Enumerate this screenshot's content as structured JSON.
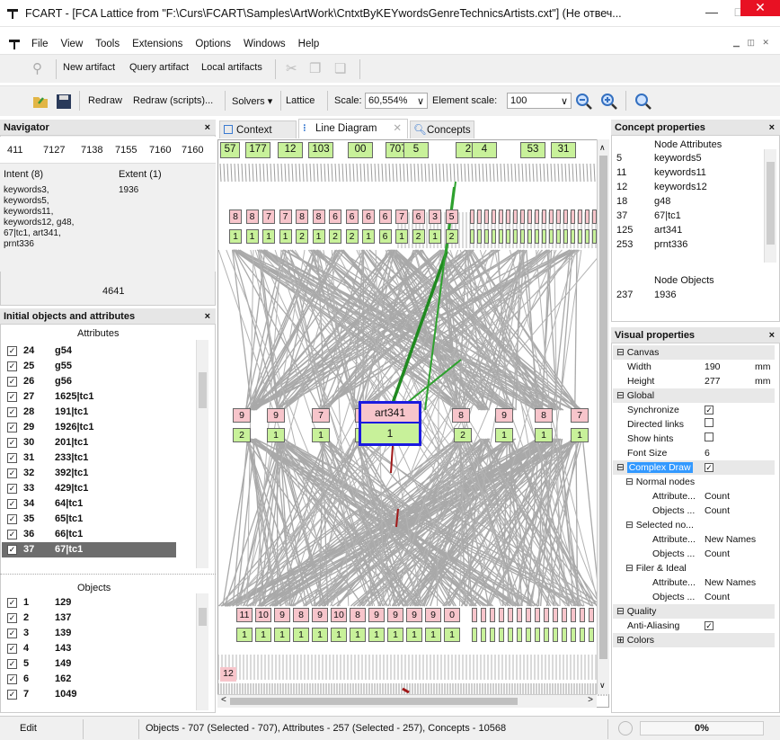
{
  "window": {
    "title": "FCART - [FCA Lattice from \"F:\\Curs\\FCART\\Samples\\ArtWork\\CntxtByKEYwordsGenreTechnicsArtists.cxt\"] (Не отвеч...",
    "minimize": "—",
    "maximize": "□",
    "close": "✕"
  },
  "menu": [
    "File",
    "View",
    "Tools",
    "Extensions",
    "Options",
    "Windows",
    "Help"
  ],
  "toolbar1": {
    "new_artifact": "New artifact",
    "query_artifact": "Query artifact",
    "local_artifacts": "Local artifacts"
  },
  "toolbar2": {
    "redraw": "Redraw",
    "redraw_scripts": "Redraw (scripts)...",
    "solvers": "Solvers ▾",
    "lattice": "Lattice",
    "scale_label": "Scale:",
    "scale_value": "60,554%",
    "element_scale_label": "Element scale:",
    "element_scale_value": "100"
  },
  "navigator": {
    "title": "Navigator",
    "close": "×",
    "numbers": [
      "411",
      "7127",
      "7138",
      "7155",
      "7160"
    ],
    "intent_header": "Intent (8)",
    "extent_header": "Extent (1)",
    "intent_text": "keywords3, keywords5, keywords11, keywords12, g48, 67|tc1, art341, prnt336",
    "extent_text": "1936",
    "bottom_value": "4641"
  },
  "initial": {
    "title": "Initial objects and attributes",
    "close": "×",
    "attributes_header": "Attributes",
    "attributes": [
      {
        "n": "24",
        "v": "g54"
      },
      {
        "n": "25",
        "v": "g55"
      },
      {
        "n": "26",
        "v": "g56"
      },
      {
        "n": "27",
        "v": "1625|tc1"
      },
      {
        "n": "28",
        "v": "191|tc1"
      },
      {
        "n": "29",
        "v": "1926|tc1"
      },
      {
        "n": "30",
        "v": "201|tc1"
      },
      {
        "n": "31",
        "v": "233|tc1"
      },
      {
        "n": "32",
        "v": "392|tc1"
      },
      {
        "n": "33",
        "v": "429|tc1"
      },
      {
        "n": "34",
        "v": "64|tc1"
      },
      {
        "n": "35",
        "v": "65|tc1"
      },
      {
        "n": "36",
        "v": "66|tc1"
      },
      {
        "n": "37",
        "v": "67|tc1"
      }
    ],
    "objects_header": "Objects",
    "objects": [
      {
        "n": "1",
        "v": "129"
      },
      {
        "n": "2",
        "v": "137"
      },
      {
        "n": "3",
        "v": "139"
      },
      {
        "n": "4",
        "v": "143"
      },
      {
        "n": "5",
        "v": "149"
      },
      {
        "n": "6",
        "v": "162"
      },
      {
        "n": "7",
        "v": "1049"
      }
    ]
  },
  "tabs": [
    "Context",
    "Line Diagram",
    "Concepts"
  ],
  "diagram": {
    "top_labels": [
      "57",
      "177",
      "12",
      "103",
      "00",
      "707",
      "5",
      "2",
      "4",
      "53",
      "31"
    ],
    "pink1": [
      "8",
      "8",
      "7",
      "7",
      "8",
      "8",
      "6",
      "6",
      "6",
      "6",
      "7",
      "6",
      "3",
      "5"
    ],
    "green1": [
      "1",
      "1",
      "1",
      "1",
      "2",
      "1",
      "2",
      "2",
      "1",
      "6",
      "1",
      "2",
      "1",
      "2"
    ],
    "mid_pink": [
      "9",
      "9",
      "7",
      "7",
      "8",
      "9",
      "8",
      "7"
    ],
    "mid_green": [
      "2",
      "1",
      "1",
      "1",
      "2",
      "1",
      "1",
      "1"
    ],
    "selected_top": "art341",
    "selected_bottom": "1",
    "pink3": [
      "11",
      "10",
      "9",
      "8",
      "9",
      "10",
      "8",
      "9",
      "9",
      "9",
      "9",
      "0"
    ],
    "green3": [
      "1",
      "1",
      "1",
      "1",
      "1",
      "1",
      "1",
      "1",
      "1",
      "1",
      "1",
      "1"
    ],
    "bottom_left": "12"
  },
  "concept_props": {
    "title": "Concept properties",
    "close": "×",
    "attr_header": "Node Attributes",
    "attrs": [
      {
        "n": "5",
        "v": "keywords5"
      },
      {
        "n": "11",
        "v": "keywords11"
      },
      {
        "n": "12",
        "v": "keywords12"
      },
      {
        "n": "18",
        "v": "g48"
      },
      {
        "n": "37",
        "v": "67|tc1"
      },
      {
        "n": "125",
        "v": "art341"
      },
      {
        "n": "253",
        "v": "prnt336"
      }
    ],
    "obj_header": "Node Objects",
    "objs": [
      {
        "n": "237",
        "v": "1936"
      }
    ]
  },
  "visual": {
    "title": "Visual properties",
    "close": "×",
    "canvas": "Canvas",
    "width_label": "Width",
    "width_value": "190",
    "width_unit": "mm",
    "height_label": "Height",
    "height_value": "277",
    "height_unit": "mm",
    "global": "Global",
    "synchronize": "Synchronize",
    "directed": "Directed links",
    "hints": "Show hints",
    "font_label": "Font Size",
    "font_value": "6",
    "complex": "Complex Draw",
    "normal": "Normal nodes",
    "attr_label": "Attribute...",
    "attr_value": "Count",
    "obj_label": "Objects ...",
    "obj_value": "Count",
    "selected": "Selected no...",
    "sel_attr_value": "New Names",
    "sel_obj_value": "Count",
    "filer": "Filer & Ideal",
    "filer_attr_value": "New Names",
    "filer_obj_value": "Count",
    "quality": "Quality",
    "aa": "Anti-Aliasing",
    "colors": "Colors"
  },
  "status": {
    "mode": "Edit",
    "info": "Objects - 707 (Selected - 707), Attributes - 257 (Selected - 257), Concepts - 10568",
    "progress": "0%"
  }
}
